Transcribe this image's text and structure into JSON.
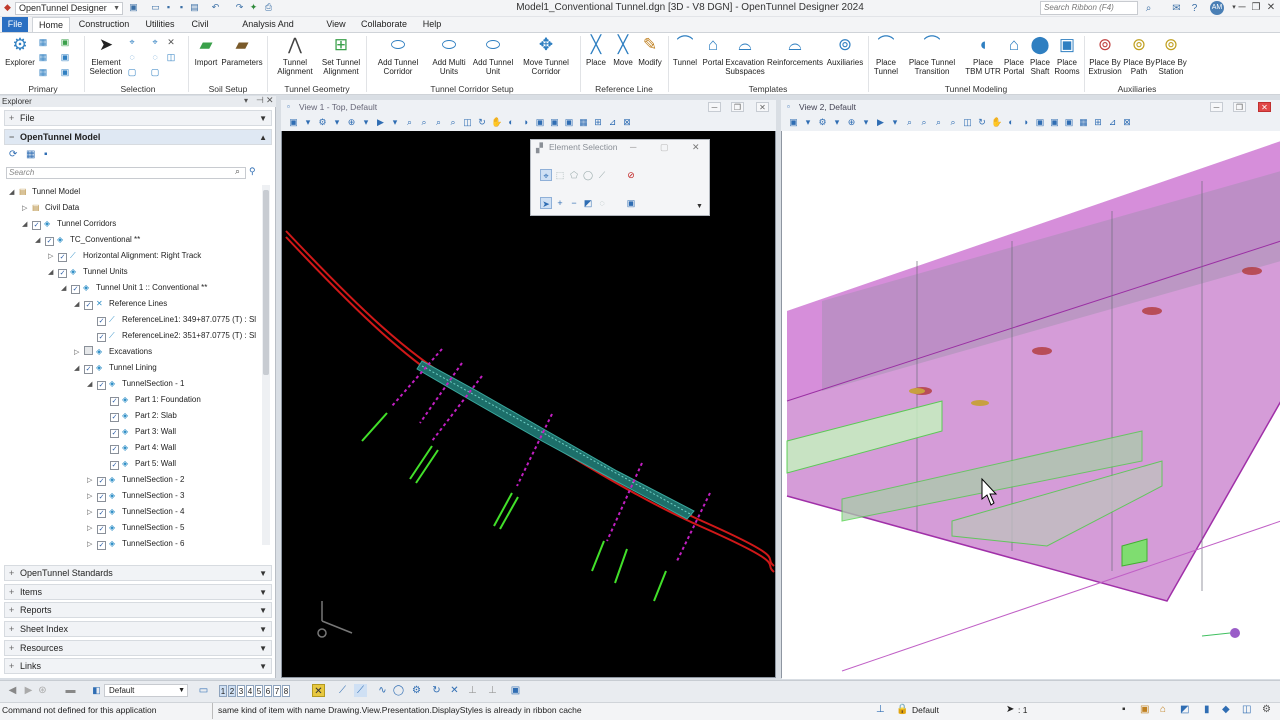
{
  "titlebar": {
    "workspace": "OpenTunnel Designer",
    "doc_title": "Model1_Conventional Tunnel.dgn [3D - V8 DGN] - OpenTunnel Designer 2024",
    "search_placeholder": "Search Ribbon (F4)",
    "avatar": "AM"
  },
  "menu": {
    "file": "File",
    "tabs": [
      "Home",
      "Construction",
      "Utilities",
      "Civil",
      "Analysis And Reporting",
      "View",
      "Collaborate",
      "Help"
    ]
  },
  "ribbon": {
    "buttons": {
      "explorer": "Explorer",
      "element_selection": "Element Selection",
      "import": "Import",
      "parameters": "Parameters",
      "tunnel_alignment": "Tunnel Alignment",
      "set_tunnel_alignment": "Set Tunnel Alignment",
      "add_tunnel_corridor": "Add Tunnel Corridor",
      "add_multi_units": "Add Multi Units",
      "add_tunnel_unit": "Add Tunnel Unit",
      "move_tunnel_corridor": "Move Tunnel Corridor",
      "place": "Place",
      "move": "Move",
      "modify": "Modify",
      "tunnel": "Tunnel",
      "portal": "Portal",
      "excavation_subspaces": "Excavation Subspaces",
      "reinforcements": "Reinforcements",
      "auxiliaries": "Auxiliaries",
      "place_tunnel": "Place Tunnel",
      "place_tunnel_transition": "Place Tunnel Transition",
      "place_tbm_utr": "Place TBM UTR",
      "place_portal": "Place Portal",
      "place_shaft": "Place Shaft",
      "place_rooms": "Place Rooms",
      "place_by_extrusion": "Place By Extrusion",
      "place_by_path": "Place By Path",
      "place_by_station": "Place By Station"
    },
    "groups": {
      "primary": "Primary",
      "selection": "Selection",
      "soil_setup": "Soil Setup",
      "tunnel_geometry": "Tunnel Geometry",
      "tunnel_corridor_setup": "Tunnel Corridor Setup",
      "reference_line": "Reference Line",
      "templates": "Templates",
      "tunnel_modeling": "Tunnel Modeling",
      "auxiliaries": "Auxiliaries"
    }
  },
  "explorer": {
    "header": "Explorer",
    "file": "File",
    "model": "OpenTunnel Model",
    "search_placeholder": "Search",
    "tree": [
      "Tunnel Model",
      "Civil Data",
      "Tunnel Corridors",
      "TC_Conventional **",
      "Horizontal Alignment: Right Track",
      "Tunnel Units",
      "Tunnel Unit 1 :: Conventional **",
      "Reference Lines",
      "ReferenceLine1: 349+87.0775 (T) : Sl",
      "ReferenceLine2: 351+87.0775 (T) : Sl",
      "Excavations",
      "Tunnel Lining",
      "TunnelSection - 1",
      "Part 1: Foundation",
      "Part 2: Slab",
      "Part 3: Wall",
      "Part 4: Wall",
      "Part 5: Wall",
      "TunnelSection - 2",
      "TunnelSection - 3",
      "TunnelSection - 4",
      "TunnelSection - 5",
      "TunnelSection - 6"
    ],
    "sections": [
      "OpenTunnel Standards",
      "Items",
      "Reports",
      "Sheet Index",
      "Resources",
      "Links"
    ]
  },
  "views": {
    "view1_title": "View 1 - Top, Default",
    "view2_title": "View 2, Default"
  },
  "dialog": {
    "title": "Element Selection"
  },
  "bottom": {
    "level": "Default",
    "view_numbers": [
      "1",
      "2",
      "3",
      "4",
      "5",
      "6",
      "7",
      "8"
    ]
  },
  "status": {
    "left": "Command not defined for this application",
    "message": "same kind of item with name Drawing.View.Presentation.DisplayStyles is already in ribbon cache",
    "level": "Default",
    "count": ": 1"
  }
}
